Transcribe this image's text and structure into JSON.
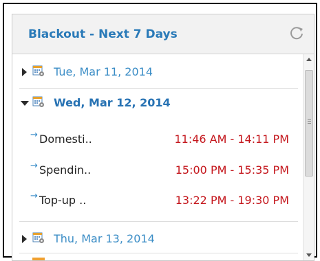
{
  "widget": {
    "title": "Blackout - Next 7 Days",
    "refresh_icon": "refresh-icon"
  },
  "days": [
    {
      "date": "Tue, Mar 11, 2014",
      "expanded": false
    },
    {
      "date": "Wed, Mar 12, 2014",
      "expanded": true,
      "events": [
        {
          "name": "Domesti..",
          "time": "11:46 AM - 14:11 PM"
        },
        {
          "name": "Spendin..",
          "time": "15:00 PM - 15:35 PM"
        },
        {
          "name": "Top-up ..",
          "time": "13:22 PM - 19:30 PM"
        }
      ]
    },
    {
      "date": "Thu, Mar 13, 2014",
      "expanded": false
    }
  ],
  "colors": {
    "title": "#2a7ab8",
    "date": "#3b8dc6",
    "time": "#c4161c",
    "header_bg": "#f2f2f2"
  },
  "icons": {
    "expand": "triangle-right-icon",
    "collapse": "triangle-down-icon",
    "calendar": "calendar-settings-icon",
    "event": "arrow-right-icon"
  }
}
